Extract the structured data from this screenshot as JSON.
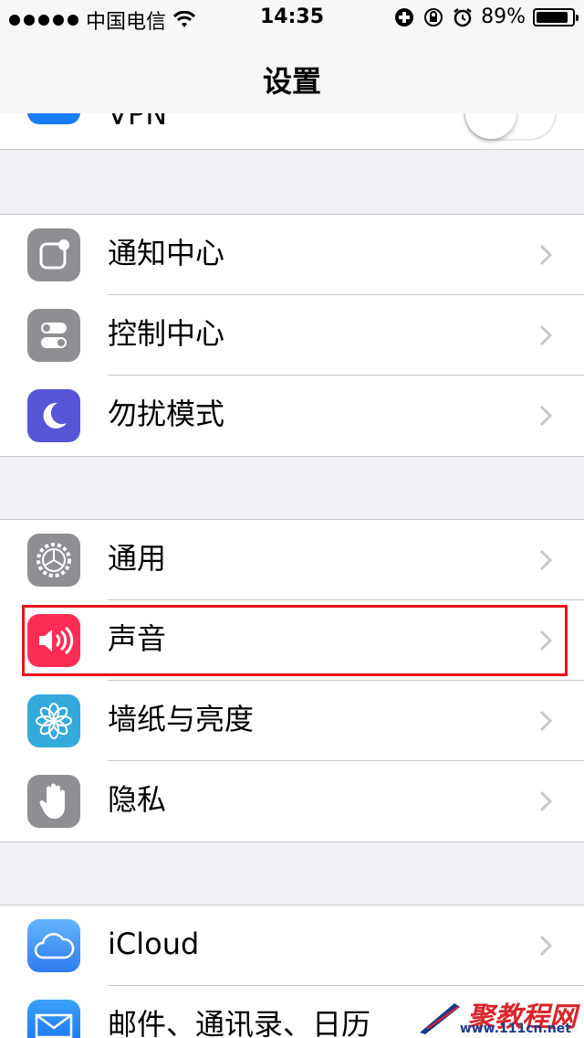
{
  "status_bar": {
    "carrier": "中国电信",
    "time": "14:35",
    "battery_percent": "89%",
    "battery_level": 0.89,
    "icons": [
      "signal-dots",
      "wifi-icon",
      "plus-icon",
      "rotation-lock-icon",
      "alarm-icon",
      "battery-icon"
    ]
  },
  "navbar": {
    "title": "设置"
  },
  "vpn_row": {
    "label": "VPN",
    "toggle_on": false
  },
  "group1": [
    {
      "label": "通知中心",
      "icon": "notification-center-icon",
      "color": "#8e8e93"
    },
    {
      "label": "控制中心",
      "icon": "control-center-icon",
      "color": "#8e8e93"
    },
    {
      "label": "勿扰模式",
      "icon": "moon-icon",
      "color": "#5856d6"
    }
  ],
  "group2": [
    {
      "label": "通用",
      "icon": "gear-icon",
      "color": "#8e8e93"
    },
    {
      "label": "声音",
      "icon": "speaker-icon",
      "color": "#ff2d55"
    },
    {
      "label": "墙纸与亮度",
      "icon": "flower-icon",
      "color": "#34aadc"
    },
    {
      "label": "隐私",
      "icon": "hand-icon",
      "color": "#8e8e93"
    }
  ],
  "group3": [
    {
      "label": "iCloud",
      "icon": "cloud-icon",
      "color": "#4b9cf5"
    },
    {
      "label": "邮件、通讯录、日历",
      "icon": "mail-icon",
      "color": "#1a7cf5"
    }
  ],
  "highlighted_row": "声音",
  "watermark": {
    "text": "聚教程网",
    "sub": "www.111cn.net"
  }
}
